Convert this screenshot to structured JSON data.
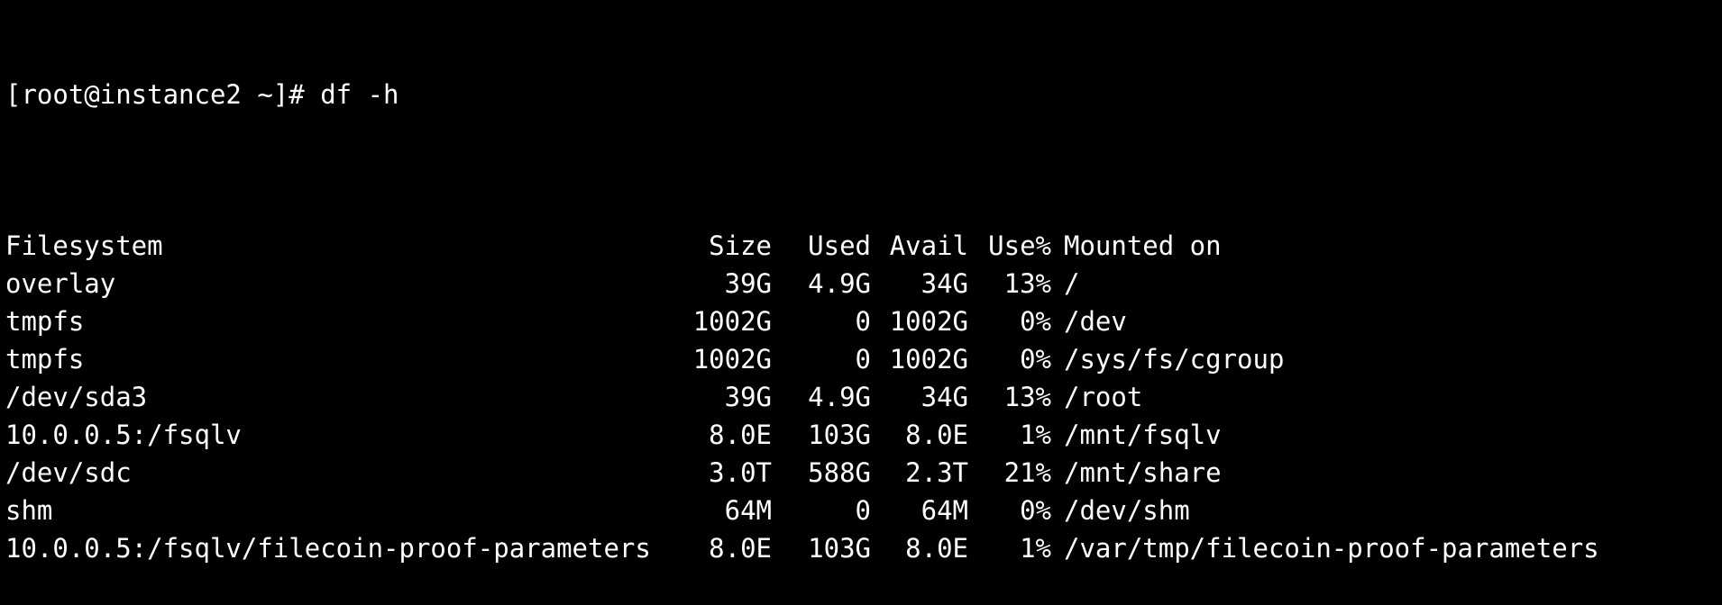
{
  "terminal": {
    "prompt": "[root@instance2 ~]# ",
    "command": "df -h",
    "colors": {
      "background": "#000000",
      "foreground": "#ffffff"
    }
  },
  "df": {
    "headers": {
      "filesystem": "Filesystem",
      "size": "Size",
      "used": "Used",
      "avail": "Avail",
      "use_pct": "Use%",
      "mounted_on": "Mounted on"
    },
    "rows": [
      {
        "filesystem": "overlay",
        "size": "39G",
        "used": "4.9G",
        "avail": "34G",
        "use_pct": "13%",
        "mounted_on": "/"
      },
      {
        "filesystem": "tmpfs",
        "size": "1002G",
        "used": "0",
        "avail": "1002G",
        "use_pct": "0%",
        "mounted_on": "/dev"
      },
      {
        "filesystem": "tmpfs",
        "size": "1002G",
        "used": "0",
        "avail": "1002G",
        "use_pct": "0%",
        "mounted_on": "/sys/fs/cgroup"
      },
      {
        "filesystem": "/dev/sda3",
        "size": "39G",
        "used": "4.9G",
        "avail": "34G",
        "use_pct": "13%",
        "mounted_on": "/root"
      },
      {
        "filesystem": "10.0.0.5:/fsqlv",
        "size": "8.0E",
        "used": "103G",
        "avail": "8.0E",
        "use_pct": "1%",
        "mounted_on": "/mnt/fsqlv"
      },
      {
        "filesystem": "/dev/sdc",
        "size": "3.0T",
        "used": "588G",
        "avail": "2.3T",
        "use_pct": "21%",
        "mounted_on": "/mnt/share"
      },
      {
        "filesystem": "shm",
        "size": "64M",
        "used": "0",
        "avail": "64M",
        "use_pct": "0%",
        "mounted_on": "/dev/shm"
      },
      {
        "filesystem": "10.0.0.5:/fsqlv/filecoin-proof-parameters",
        "size": "8.0E",
        "used": "103G",
        "avail": "8.0E",
        "use_pct": "1%",
        "mounted_on": "/var/tmp/filecoin-proof-parameters"
      }
    ]
  }
}
